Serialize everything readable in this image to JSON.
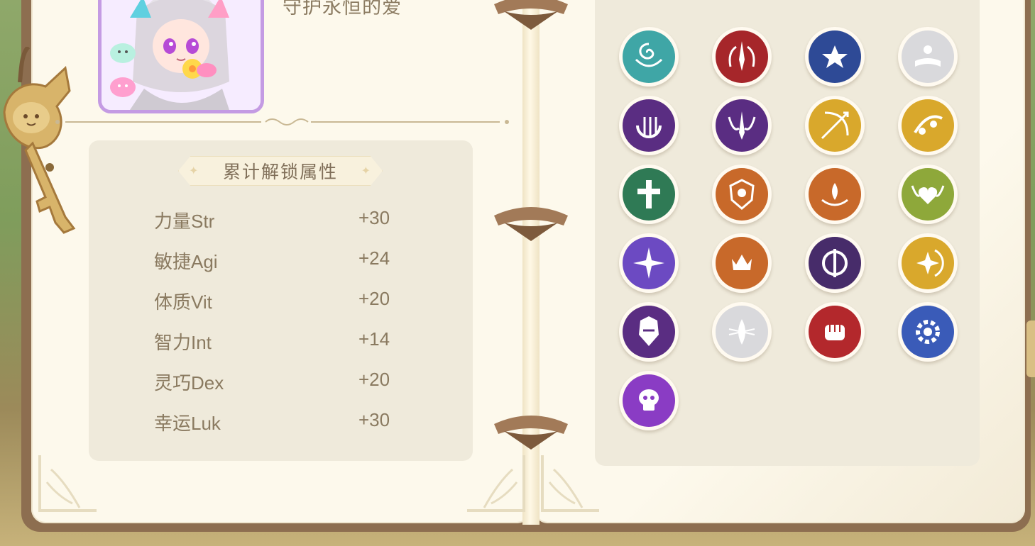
{
  "top": {
    "character_name": "守护永恒的爱"
  },
  "attributes_panel": {
    "title": "累计解锁属性",
    "stats": [
      {
        "name": "力量Str",
        "value": "+30"
      },
      {
        "name": "敏捷Agi",
        "value": "+24"
      },
      {
        "name": "体质Vit",
        "value": "+20"
      },
      {
        "name": "智力Int",
        "value": "+14"
      },
      {
        "name": "灵巧Dex",
        "value": "+20"
      },
      {
        "name": "幸运Luk",
        "value": "+30"
      }
    ]
  },
  "badges": [
    {
      "icon": "ornate-swirl-icon",
      "color": "#3fa6a6",
      "locked": false
    },
    {
      "icon": "flame-sword-icon",
      "color": "#a6262a",
      "locked": false
    },
    {
      "icon": "winged-star-icon",
      "color": "#2e4a96",
      "locked": false
    },
    {
      "icon": "book-icon",
      "color": "#d9d9dc",
      "locked": true
    },
    {
      "icon": "trident-crescent-icon",
      "color": "#5a2d82",
      "locked": false
    },
    {
      "icon": "dagger-wings-icon",
      "color": "#5a2d82",
      "locked": false
    },
    {
      "icon": "bow-arrow-icon",
      "color": "#d9a82c",
      "locked": false
    },
    {
      "icon": "music-note-icon",
      "color": "#d9a82c",
      "locked": false
    },
    {
      "icon": "holy-cross-icon",
      "color": "#2f7a55",
      "locked": false
    },
    {
      "icon": "crest-shield-icon",
      "color": "#c8692a",
      "locked": false
    },
    {
      "icon": "lotus-icon",
      "color": "#c8692a",
      "locked": false
    },
    {
      "icon": "winged-heart-icon",
      "color": "#8ea83a",
      "locked": false
    },
    {
      "icon": "shuriken-icon",
      "color": "#6c4ac2",
      "locked": false
    },
    {
      "icon": "crown-gear-icon",
      "color": "#c8692a",
      "locked": false
    },
    {
      "icon": "scythe-icon",
      "color": "#472c6a",
      "locked": false
    },
    {
      "icon": "compass-moon-icon",
      "color": "#d9a82c",
      "locked": false
    },
    {
      "icon": "armored-helm-icon",
      "color": "#5a2d82",
      "locked": false
    },
    {
      "icon": "lotus-blade-icon",
      "color": "#d9d9dc",
      "locked": true
    },
    {
      "icon": "fist-icon",
      "color": "#b3282c",
      "locked": false
    },
    {
      "icon": "cog-icon",
      "color": "#3a5bb8",
      "locked": false
    },
    {
      "icon": "skull-icon",
      "color": "#8a3cc4",
      "locked": false
    }
  ]
}
